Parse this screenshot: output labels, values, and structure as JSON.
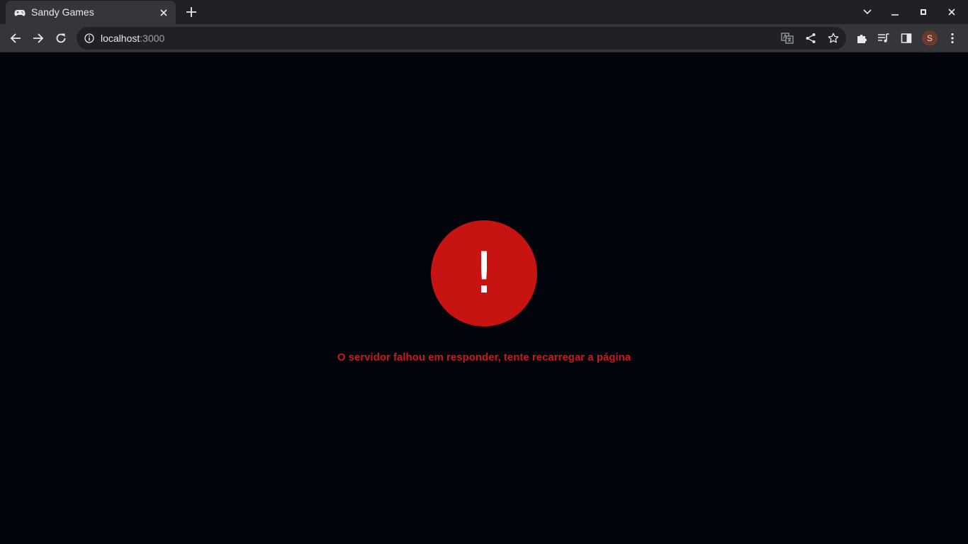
{
  "browser": {
    "tab": {
      "title": "Sandy Games",
      "favicon": "gamepad-icon"
    },
    "url": {
      "host": "localhost",
      "port": ":3000"
    },
    "profile_initial": "S"
  },
  "page": {
    "error_symbol": "!",
    "error_message": "O servidor falhou em responder, tente recarregar a página",
    "accent_color": "#c81313",
    "background_color": "#02040b"
  }
}
